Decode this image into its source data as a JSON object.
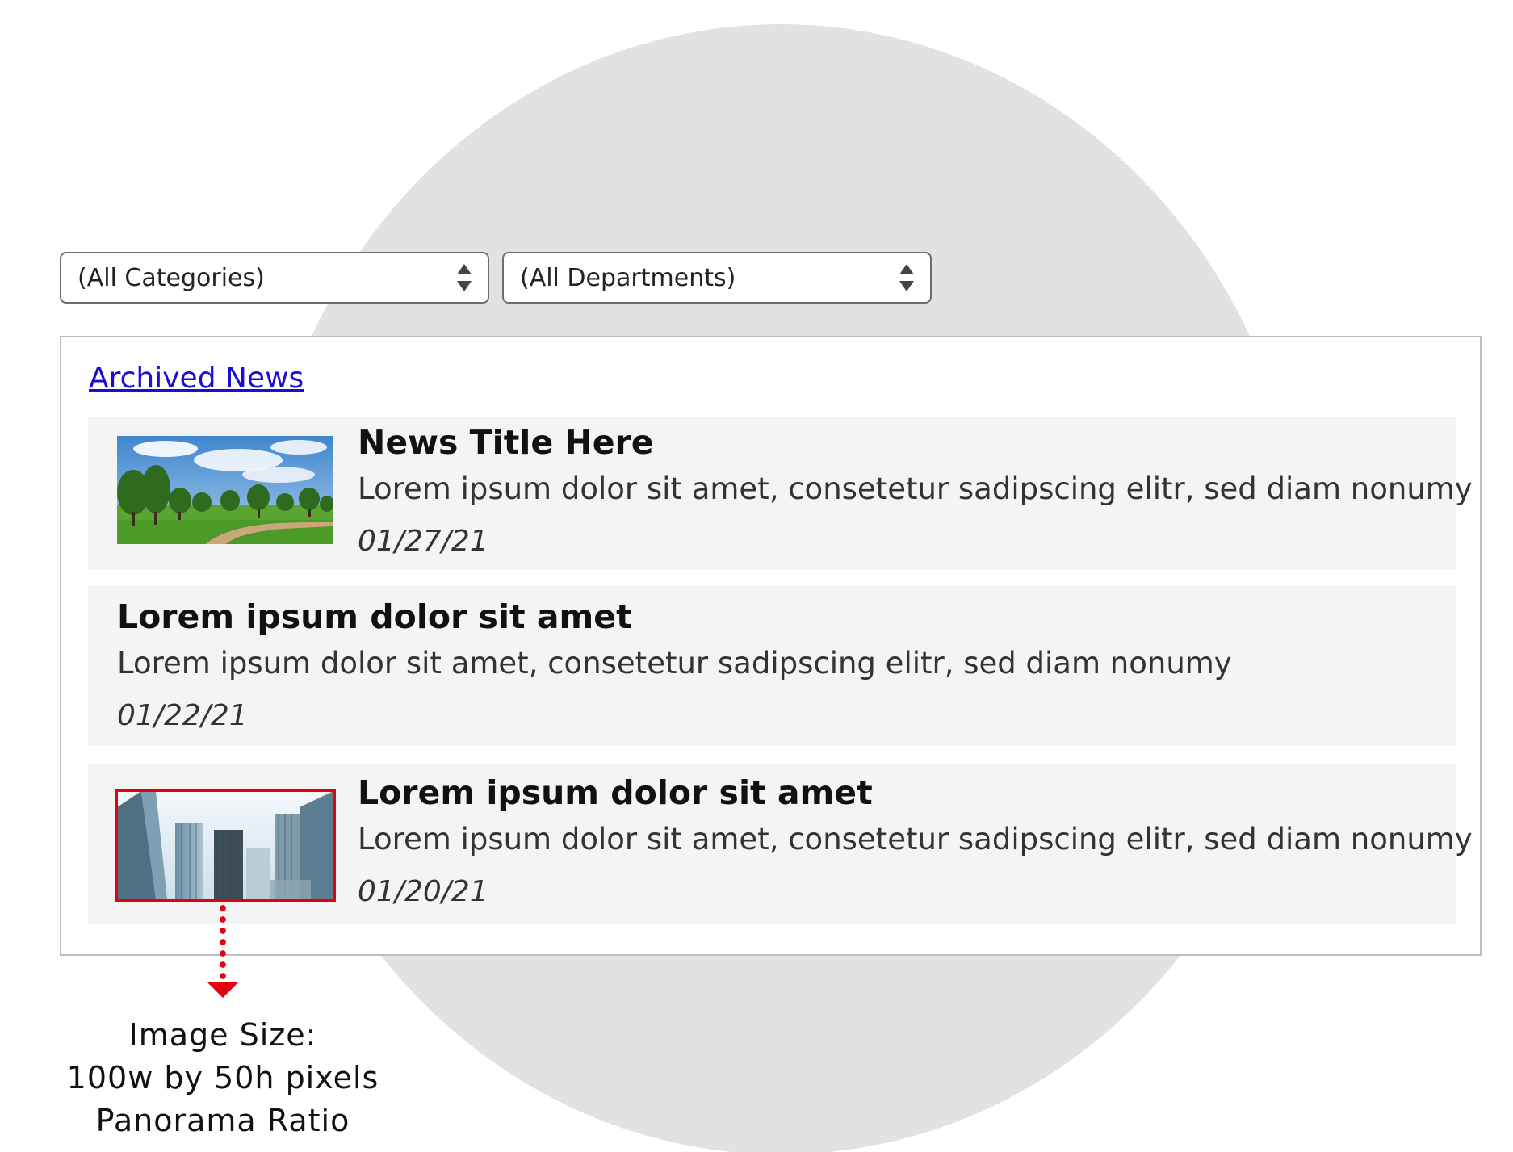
{
  "filters": {
    "category_select": {
      "selected": "(All Categories)"
    },
    "department_select": {
      "selected": "(All Departments)"
    }
  },
  "archive_link": "Archived News",
  "news_items": [
    {
      "title": "News Title Here",
      "summary": "Lorem ipsum dolor sit amet, consetetur sadipscing elitr, sed diam nonumy",
      "date": "01/27/21",
      "thumbnail": "park-landscape-image"
    },
    {
      "title": "Lorem ipsum dolor sit amet",
      "summary": "Lorem ipsum dolor sit amet, consetetur sadipscing elitr, sed diam nonumy",
      "date": "01/22/21"
    },
    {
      "title": "Lorem ipsum dolor sit amet",
      "summary": "Lorem ipsum dolor sit amet, consetetur sadipscing elitr, sed diam nonumy",
      "date": "01/20/21",
      "thumbnail": "skyscrapers-image"
    }
  ],
  "annotation": {
    "lines": [
      "Image Size:",
      "100w by 50h pixels",
      "Panorama Ratio"
    ]
  },
  "colors": {
    "link": "#1a0dd6",
    "highlight": "#e3000f",
    "item_background": "#f4f4f4",
    "backdrop_circle": "#e1e2e4"
  }
}
